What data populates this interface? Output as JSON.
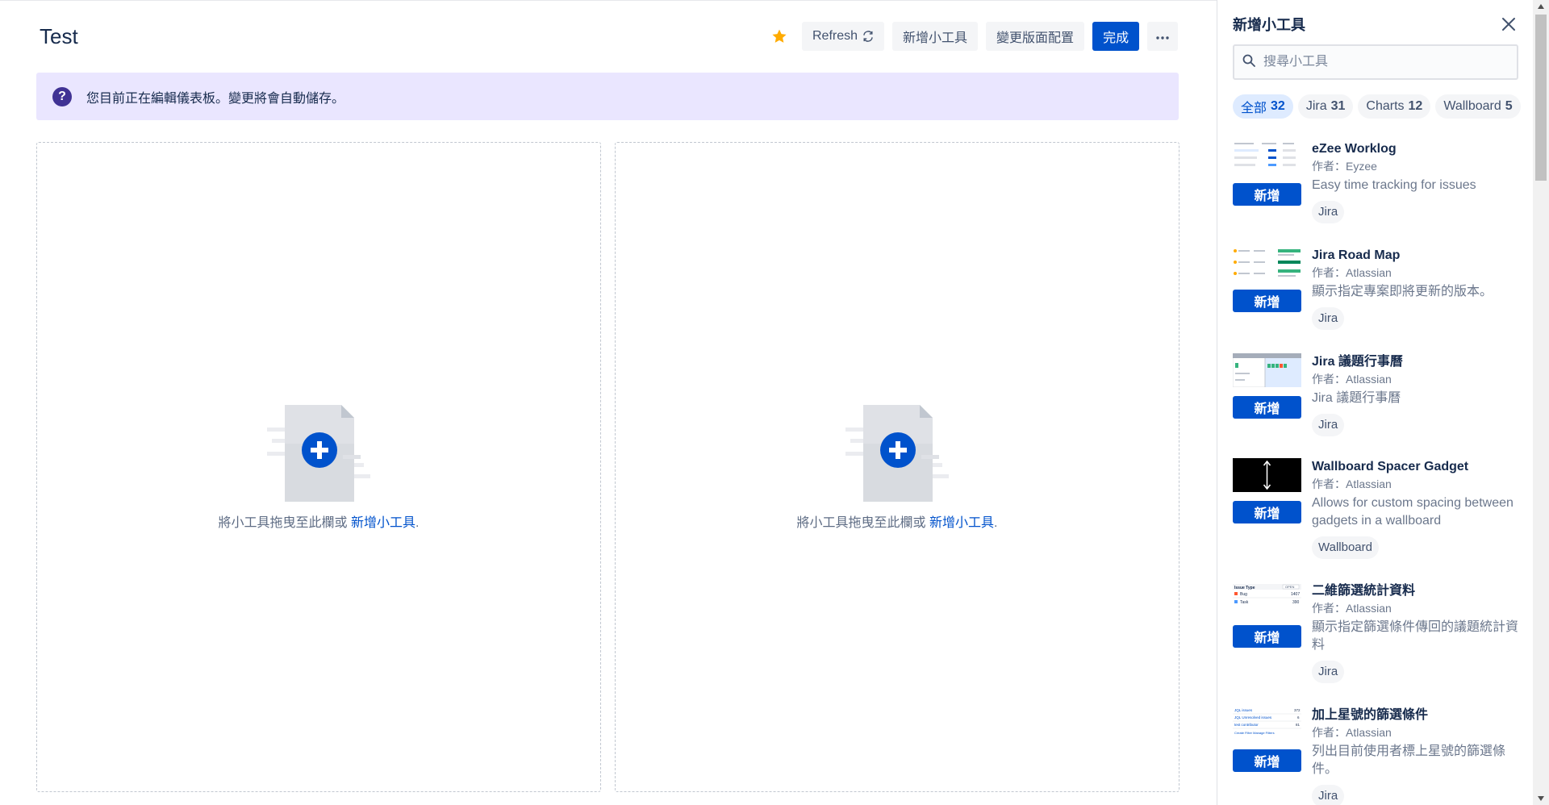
{
  "header": {
    "title": "Test",
    "refresh_label": "Refresh",
    "add_gadget_label": "新增小工具",
    "change_layout_label": "變更版面配置",
    "done_label": "完成"
  },
  "banner": {
    "text": "您目前正在編輯儀表板。變更將會自動儲存。"
  },
  "columns": [
    {
      "drop_text": "將小工具拖曳至此欄或 ",
      "link": "新增小工具",
      "suffix": "."
    },
    {
      "drop_text": "將小工具拖曳至此欄或 ",
      "link": "新增小工具",
      "suffix": "."
    }
  ],
  "sidebar": {
    "title": "新增小工具",
    "search_placeholder": "搜尋小工具",
    "filters": [
      {
        "label": "全部",
        "count": "32"
      },
      {
        "label": "Jira",
        "count": "31"
      },
      {
        "label": "Charts",
        "count": "12"
      },
      {
        "label": "Wallboard",
        "count": "5"
      }
    ],
    "add_label": "新增",
    "gadgets": [
      {
        "name": "eZee Worklog",
        "author": "作者：Eyzee",
        "desc": "Easy time tracking for issues",
        "tag": "Jira"
      },
      {
        "name": "Jira Road Map",
        "author": "作者：Atlassian",
        "desc": "顯示指定專案即將更新的版本。",
        "tag": "Jira"
      },
      {
        "name": "Jira 議題行事曆",
        "author": "作者：Atlassian",
        "desc": "Jira 議題行事曆",
        "tag": "Jira"
      },
      {
        "name": "Wallboard Spacer Gadget",
        "author": "作者：Atlassian",
        "desc": "Allows for custom spacing between gadgets in a wallboard",
        "tag": "Wallboard"
      },
      {
        "name": "二維篩選統計資料",
        "author": "作者：Atlassian",
        "desc": "顯示指定篩選條件傳回的議題統計資料",
        "tag": "Jira"
      },
      {
        "name": "加上星號的篩選條件",
        "author": "作者：Atlassian",
        "desc": "列出目前使用者標上星號的篩選條件。",
        "tag": "Jira"
      }
    ]
  },
  "thumbnails": {
    "filter_stats": {
      "col1": "Issue Type",
      "col2": "OPEN",
      "rows": [
        [
          "Bug",
          "1407"
        ],
        [
          "Task",
          "390"
        ]
      ]
    },
    "starred": {
      "rows": [
        [
          "JQL issues",
          "372"
        ],
        [
          "JQL Unresolved issues",
          "6"
        ],
        [
          "test contributor",
          "81"
        ]
      ],
      "links": "Create Filter   Manage Filters"
    }
  },
  "colors": {
    "primary": "#0052cc",
    "banner_bg": "#eae6ff",
    "star": "#ffab00"
  }
}
